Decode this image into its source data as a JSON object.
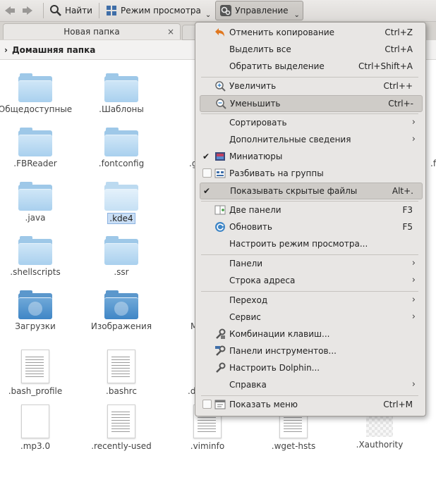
{
  "toolbar": {
    "find": "Найти",
    "view_mode": "Режим просмотра",
    "control": "Управление"
  },
  "tabs": [
    {
      "label": "Новая папка"
    }
  ],
  "breadcrumb": {
    "path": "Домашняя папка"
  },
  "files": [
    {
      "name": "Общедоступные"
    },
    {
      "name": ".Шаблоны"
    },
    {
      "name": ".FBReader"
    },
    {
      "name": ".fontconfig"
    },
    {
      "name": ".java"
    },
    {
      "name": ".kde4"
    },
    {
      "name": ".shellscripts"
    },
    {
      "name": ".ssr"
    },
    {
      "name": "Загрузки"
    },
    {
      "name": "Изображения"
    },
    {
      "name": ".bash_profile"
    },
    {
      "name": ".bashrc"
    },
    {
      "name": ".mp3.0"
    },
    {
      "name": ".recently-used"
    },
    {
      "name": ".viminfo"
    },
    {
      "name": ".wget-hsts"
    },
    {
      "name": ".Xauthority"
    }
  ],
  "partial_labels": {
    "col3_r2": ".g",
    "col3_r5": "M",
    "col3_r6": ".d",
    "col5_r2": ".f"
  },
  "menu": {
    "undo": {
      "label": "Отменить копирование",
      "shortcut": "Ctrl+Z"
    },
    "select_all": {
      "label": "Выделить все",
      "shortcut": "Ctrl+A"
    },
    "invert": {
      "label": "Обратить выделение",
      "shortcut": "Ctrl+Shift+A"
    },
    "zoom_in": {
      "label": "Увеличить",
      "shortcut": "Ctrl++"
    },
    "zoom_out": {
      "label": "Уменьшить",
      "shortcut": "Ctrl+-"
    },
    "sort": {
      "label": "Сортировать"
    },
    "details": {
      "label": "Дополнительные сведения"
    },
    "previews": {
      "label": "Миниатюры"
    },
    "groups": {
      "label": "Разбивать на группы"
    },
    "hidden": {
      "label": "Показывать скрытые файлы",
      "shortcut": "Alt+."
    },
    "split": {
      "label": "Две панели",
      "shortcut": "F3"
    },
    "reload": {
      "label": "Обновить",
      "shortcut": "F5"
    },
    "view_settings": {
      "label": "Настроить режим просмотра..."
    },
    "panels": {
      "label": "Панели"
    },
    "location_bar": {
      "label": "Строка адреса"
    },
    "go": {
      "label": "Переход"
    },
    "tools": {
      "label": "Сервис"
    },
    "shortcuts": {
      "label": "Комбинации клавиш..."
    },
    "toolbars": {
      "label": "Панели инструментов..."
    },
    "configure": {
      "label": "Настроить Dolphin..."
    },
    "help": {
      "label": "Справка"
    },
    "show_menu": {
      "label": "Показать меню",
      "shortcut": "Ctrl+M"
    }
  },
  "colors": {
    "accent": "#3f86c6",
    "folder": "#a9d0ee",
    "menu_bg": "#e8e6e4",
    "highlight": "#cfccc8"
  }
}
